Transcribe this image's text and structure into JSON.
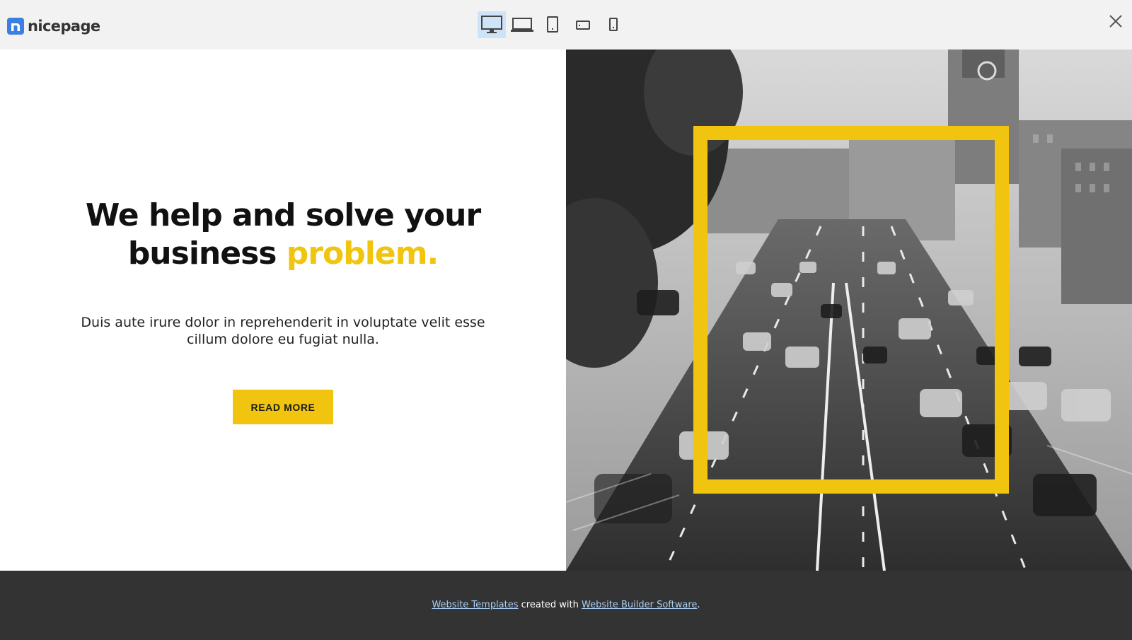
{
  "toolbar": {
    "brand": "nicepage",
    "devices": [
      {
        "name": "desktop",
        "active": true
      },
      {
        "name": "laptop",
        "active": false
      },
      {
        "name": "tablet",
        "active": false
      },
      {
        "name": "phone-landscape",
        "active": false
      },
      {
        "name": "phone-portrait",
        "active": false
      }
    ],
    "close_icon": "close-icon"
  },
  "hero": {
    "headline_main": "We help and solve your business ",
    "headline_accent": "problem.",
    "lead": "Duis aute irure dolor in reprehenderit in voluptate velit esse cillum dolore eu fugiat nulla.",
    "button_label": "READ MORE",
    "image_alt": "city-traffic-photo"
  },
  "footer": {
    "link1": "Website Templates",
    "middle": " created with ",
    "link2": "Website Builder Software",
    "end": "."
  },
  "colors": {
    "accent": "#f1c40f",
    "brand_blue": "#3d7fe0",
    "footer_bg": "#333333",
    "toolbar_bg": "#f2f2f2"
  }
}
